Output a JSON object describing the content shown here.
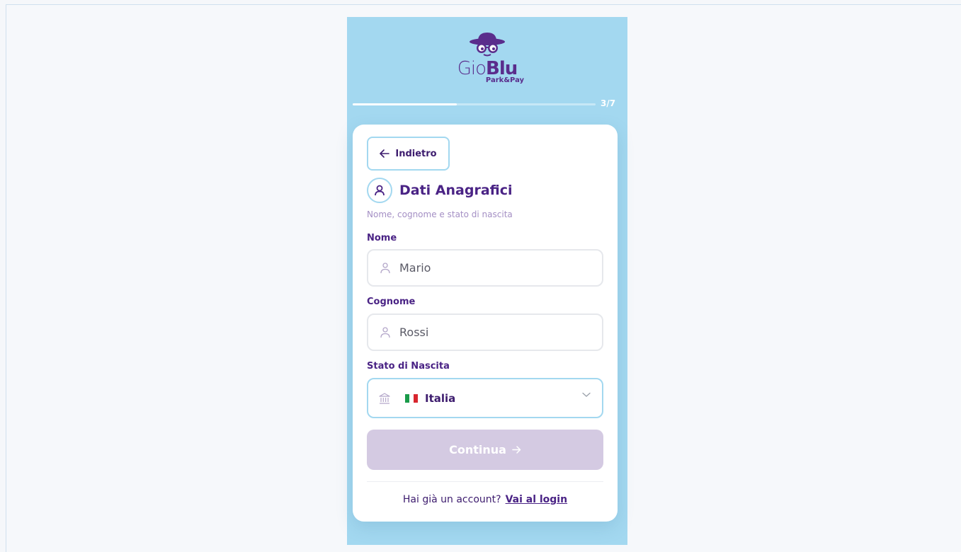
{
  "brand": {
    "name_light": "Gio",
    "name_bold": "Blu",
    "tagline": "Park&Pay"
  },
  "progress": {
    "label": "3/7",
    "fraction": 0.43
  },
  "back_button": {
    "label": "Indietro",
    "icon": "arrow-left-icon"
  },
  "section": {
    "title": "Dati Anagrafici",
    "subtitle": "Nome, cognome e stato di nascita",
    "icon": "user-icon"
  },
  "fields": {
    "nome": {
      "label": "Nome",
      "value": "Mario",
      "icon": "user-icon"
    },
    "cognome": {
      "label": "Cognome",
      "value": "Rossi",
      "icon": "user-icon"
    },
    "stato": {
      "label": "Stato di Nascita",
      "value": "Italia",
      "icon": "bank-icon",
      "flag": [
        "#1a9b4a",
        "#ffffff",
        "#d8262e"
      ]
    }
  },
  "continue_button": {
    "label": "Continua",
    "icon": "arrow-right-icon"
  },
  "footer": {
    "prompt": "Hai già un account?",
    "link": "Vai al login"
  },
  "colors": {
    "accent": "#4a2385",
    "sky": "#a3d8f0",
    "disabled": "#d4cae2"
  }
}
